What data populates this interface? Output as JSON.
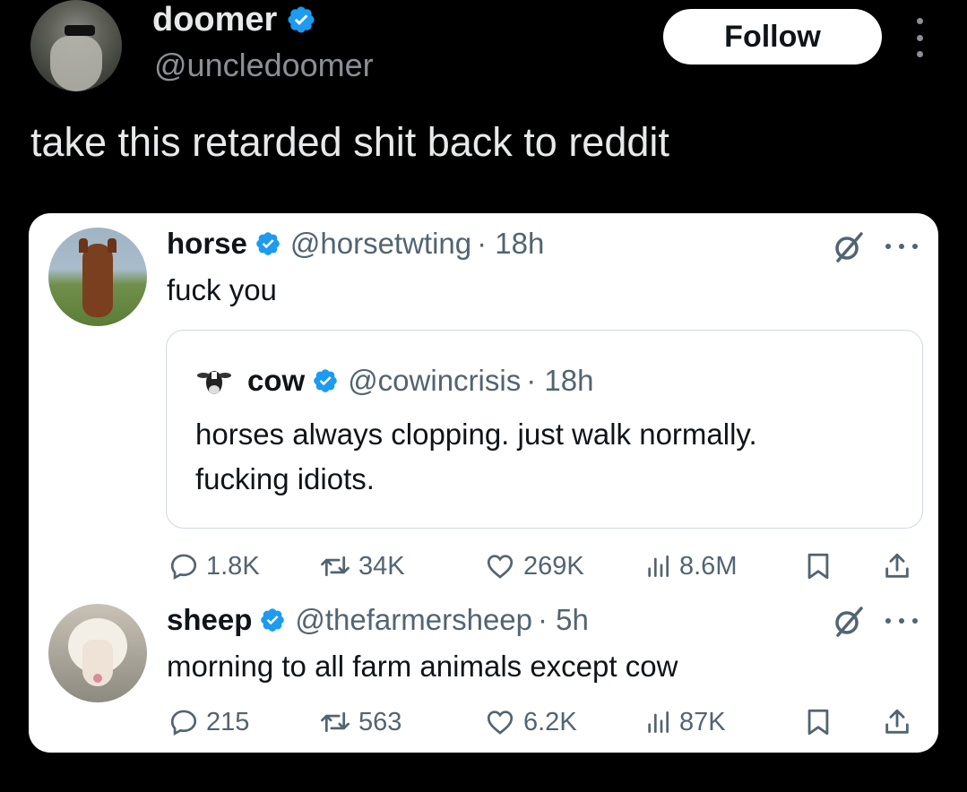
{
  "author": {
    "name": "doomer",
    "handle": "@uncledoomer",
    "follow_label": "Follow"
  },
  "tweet_text": "take this retarded shit back to reddit",
  "embedded": {
    "post1": {
      "name": "horse",
      "handle": "@horsetwting",
      "time": "· 18h",
      "text": "fuck you",
      "quote": {
        "name": "cow",
        "handle": "@cowincrisis",
        "time": "· 18h",
        "text_line1": "horses always clopping. just walk normally.",
        "text_line2": "fucking idiots."
      },
      "stats": {
        "replies": "1.8K",
        "reposts": "34K",
        "likes": "269K",
        "views": "8.6M"
      }
    },
    "post2": {
      "name": "sheep",
      "handle": "@thefarmersheep",
      "time": "· 5h",
      "text": "morning to all farm animals except cow",
      "stats": {
        "replies": "215",
        "reposts": "563",
        "likes": "6.2K",
        "views": "87K"
      }
    }
  },
  "colors": {
    "verified": "#1d9bf0",
    "muted": "#536471",
    "background": "#000000",
    "card": "#ffffff"
  },
  "icons": [
    "verified-badge-icon",
    "grok-icon",
    "more-icon",
    "reply-icon",
    "repost-icon",
    "like-icon",
    "views-icon",
    "bookmark-icon",
    "share-icon"
  ]
}
